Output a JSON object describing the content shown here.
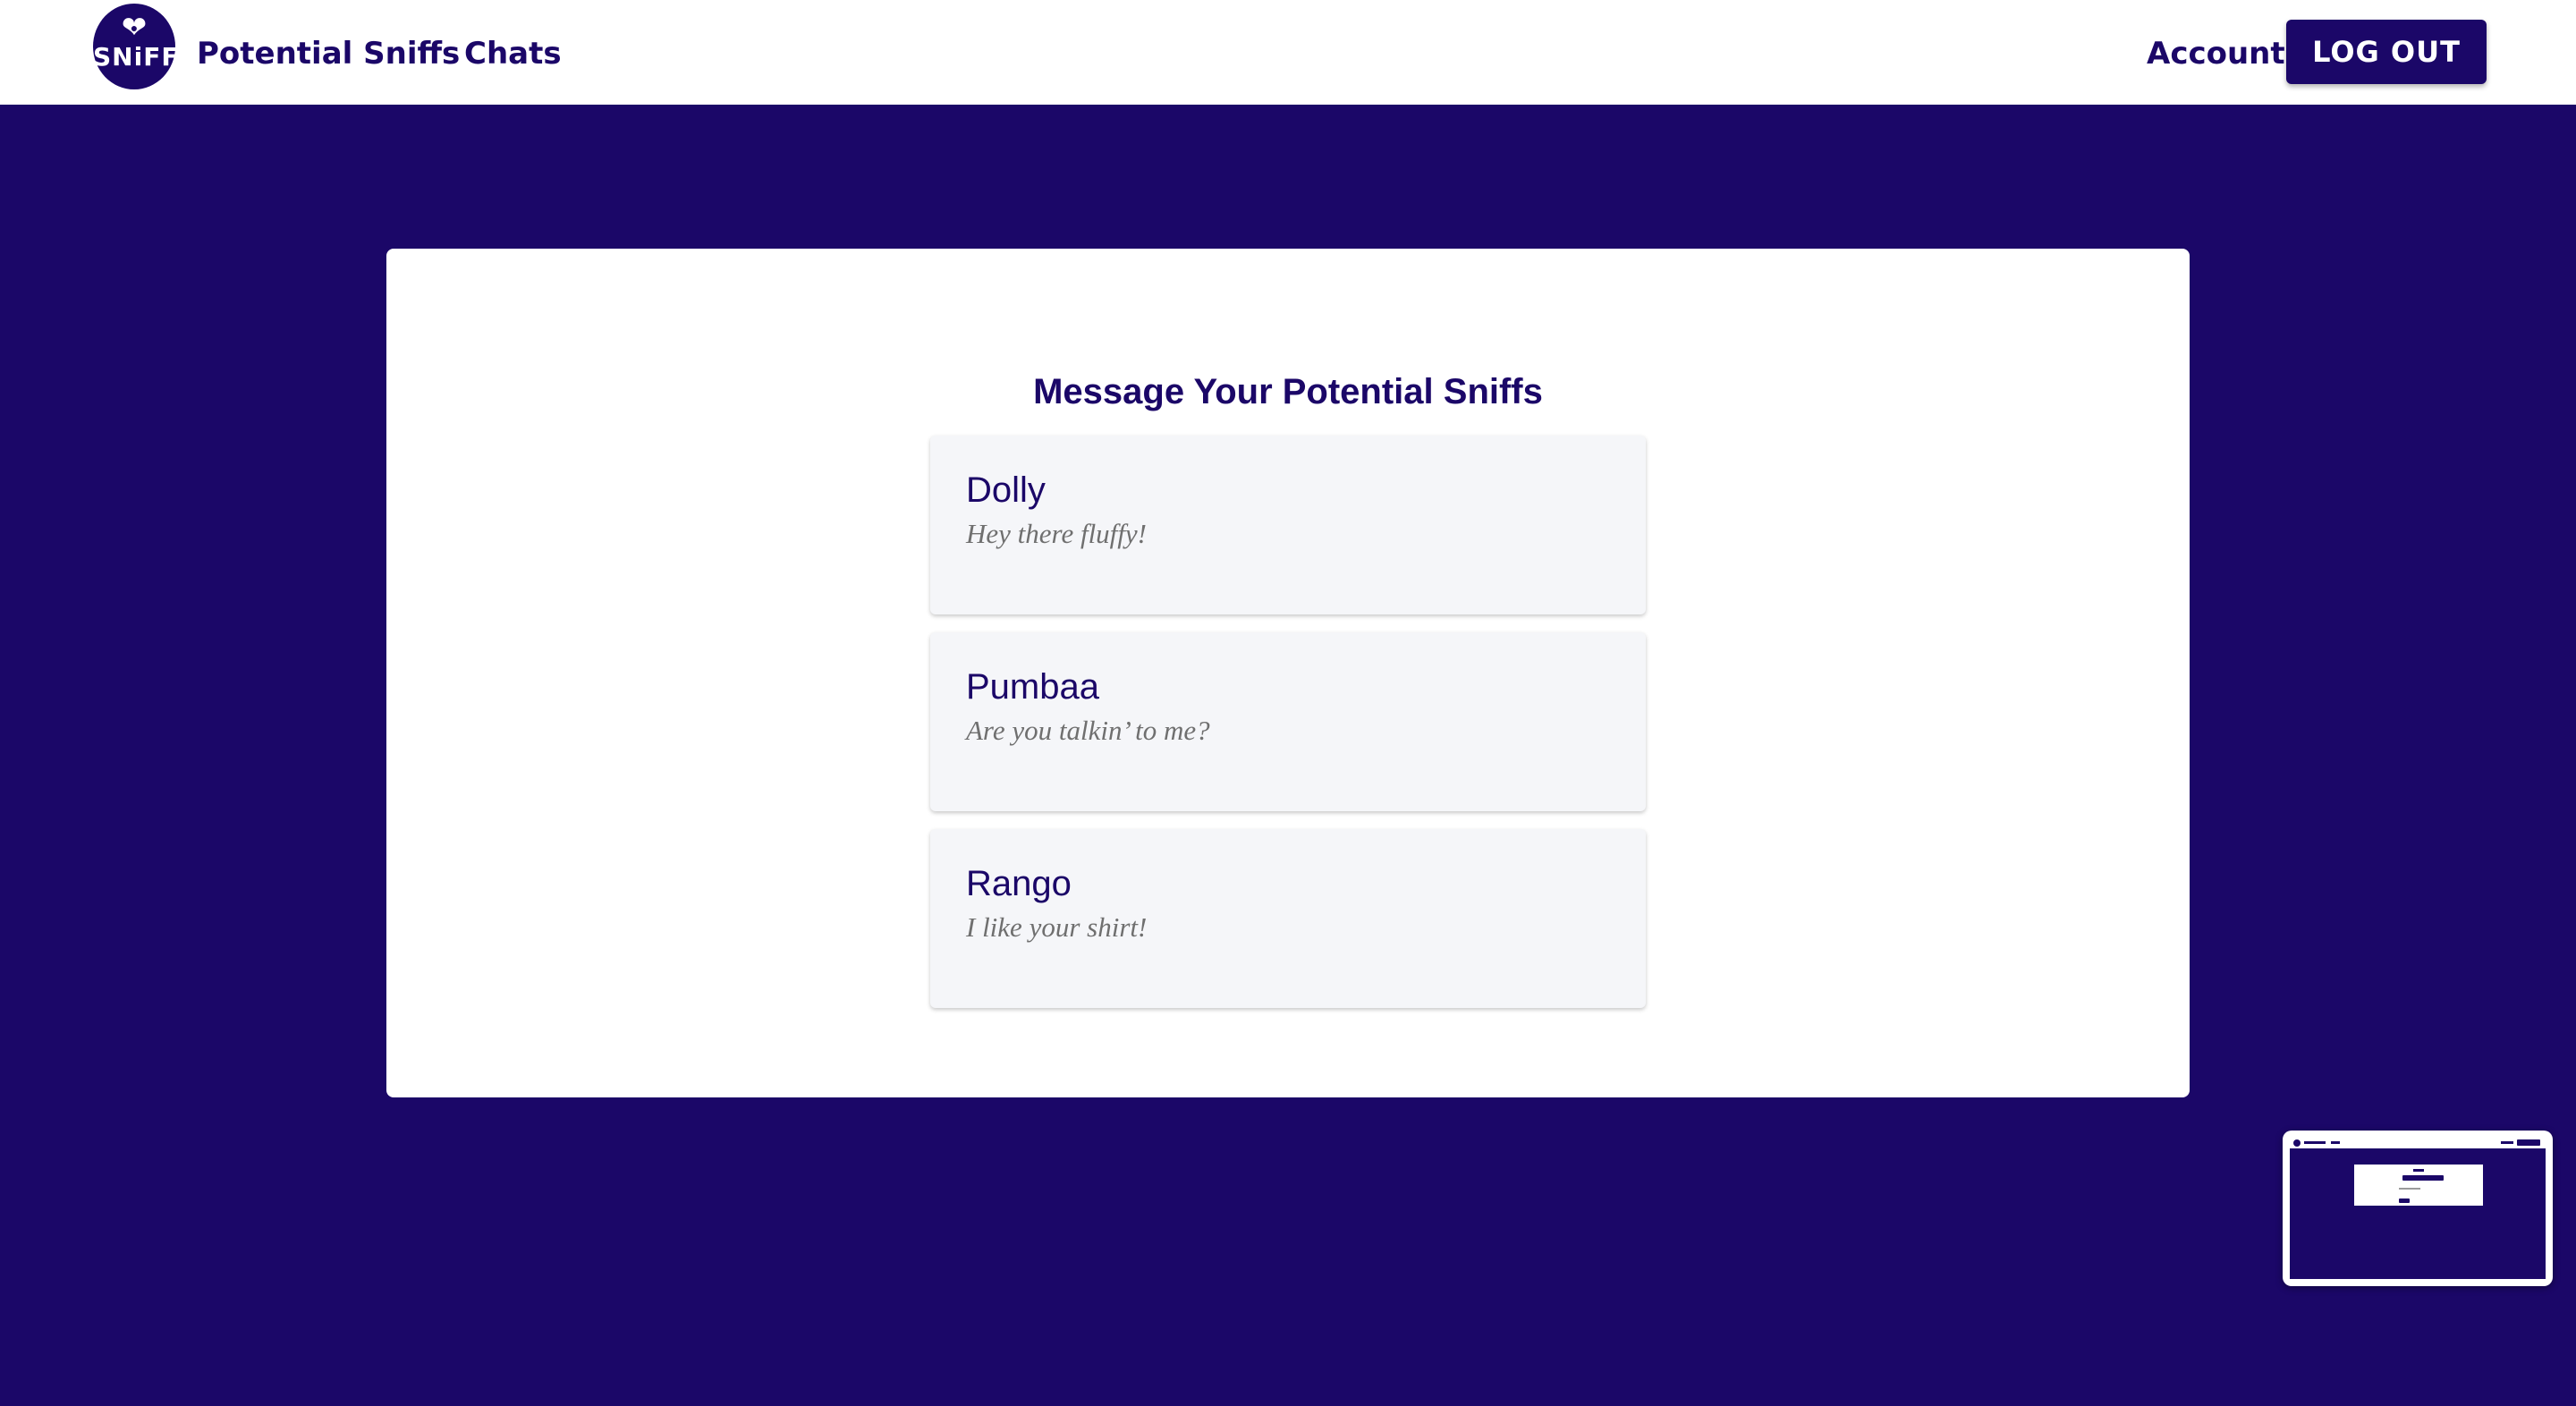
{
  "header": {
    "logo_text": "SNiFF",
    "nav": {
      "potential_sniffs": "Potential Sniffs",
      "chats": "Chats",
      "account": "Account"
    },
    "logout_label": "LOG OUT"
  },
  "main": {
    "title": "Message Your Potential Sniffs",
    "chats": [
      {
        "name": "Dolly",
        "message": "Hey there fluffy!"
      },
      {
        "name": "Pumbaa",
        "message": "Are you talkin’ to me?"
      },
      {
        "name": "Rango",
        "message": "I like your shirt!"
      }
    ]
  },
  "colors": {
    "brand": "#1b0768",
    "card_background": "#f5f6f9",
    "message_text": "#6f6f6f"
  },
  "icons": {
    "logo": "heart-paw-logo-icon"
  }
}
